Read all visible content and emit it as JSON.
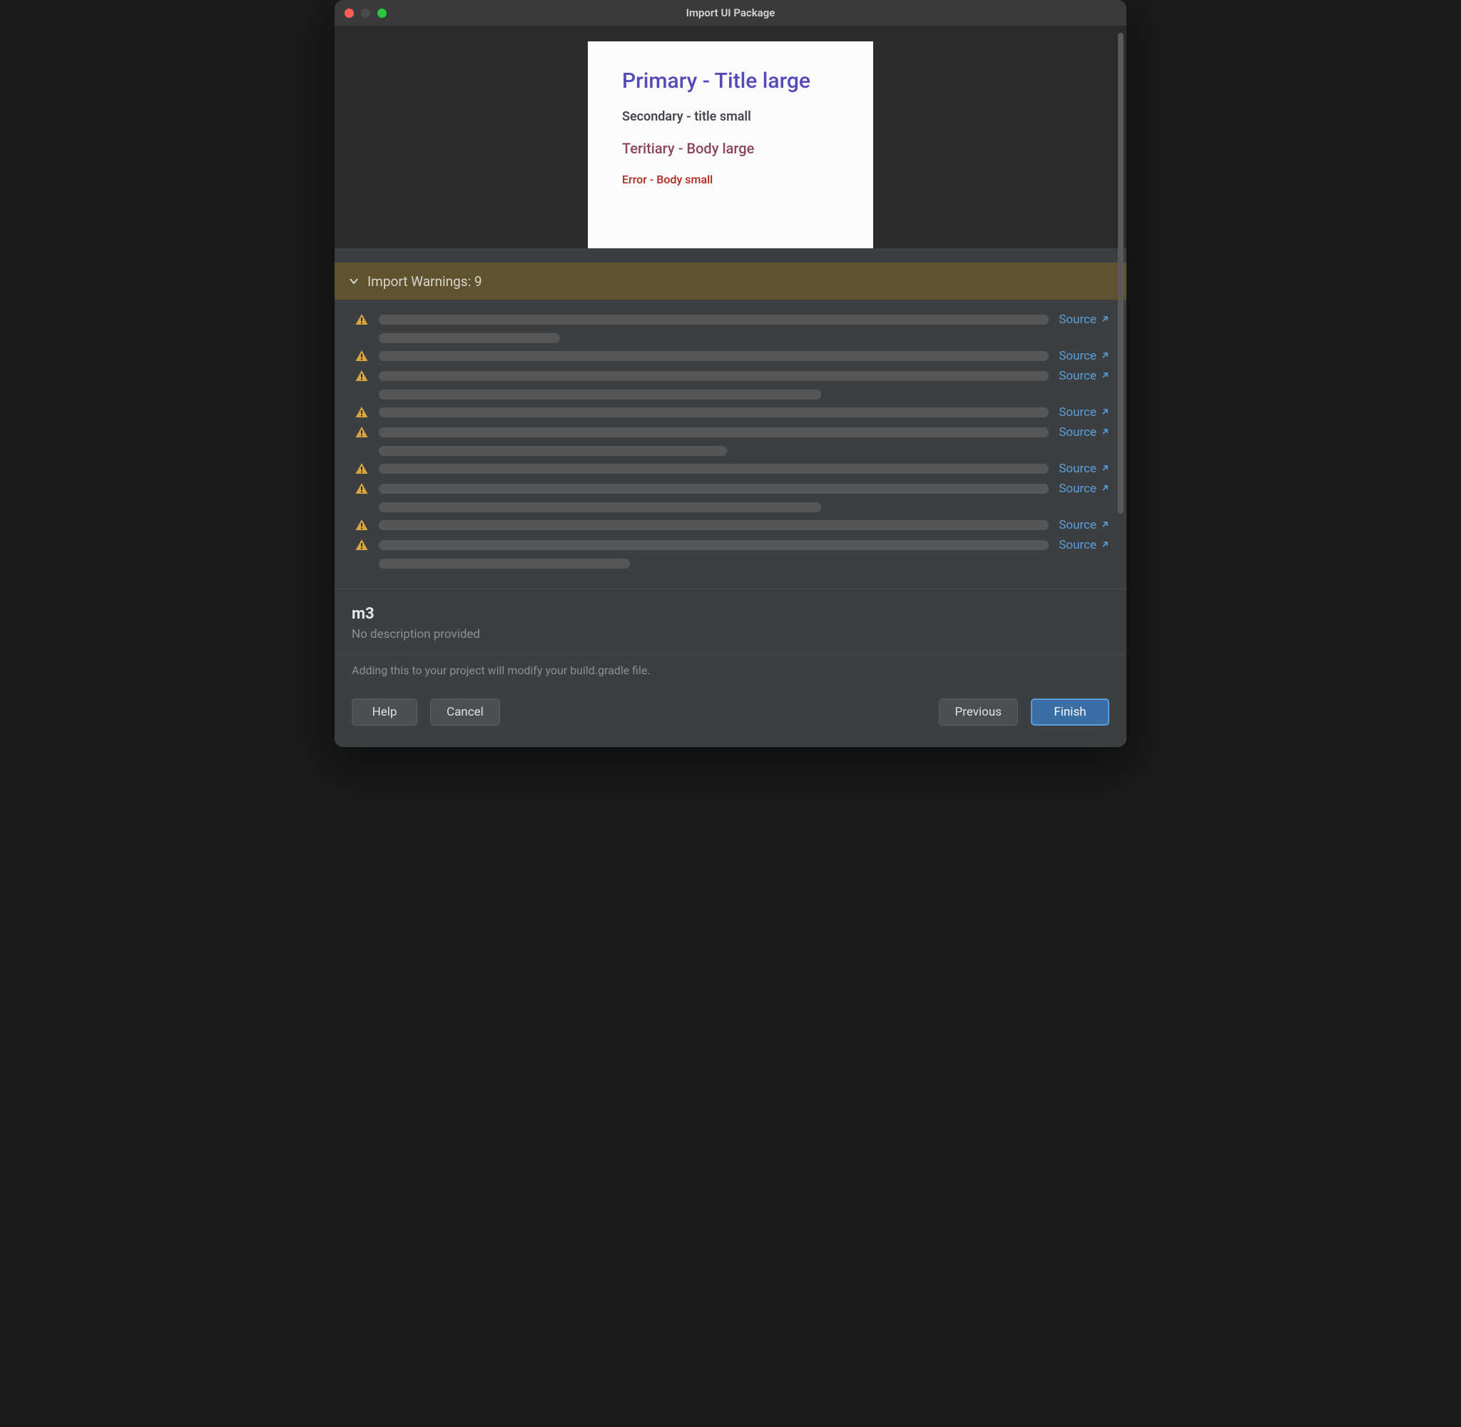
{
  "window": {
    "title": "Import UI Package"
  },
  "preview": {
    "title_large": "Primary - Title large",
    "title_small": "Secondary - title small",
    "body_large": "Teritiary - Body large",
    "body_small": "Error - Body small"
  },
  "warnings": {
    "header_label": "Import Warnings: 9",
    "count": 9,
    "source_label": "Source",
    "items": [
      {
        "lines": [
          100,
          27
        ]
      },
      {
        "lines": [
          100
        ]
      },
      {
        "lines": [
          100,
          66
        ]
      },
      {
        "lines": [
          100
        ]
      },
      {
        "lines": [
          100,
          52
        ]
      },
      {
        "lines": [
          100
        ]
      },
      {
        "lines": [
          100,
          66
        ]
      },
      {
        "lines": [
          100
        ]
      },
      {
        "lines": [
          100,
          37.5
        ]
      }
    ]
  },
  "package": {
    "name": "m3",
    "description": "No description provided"
  },
  "footer": {
    "note": "Adding this to your project will modify your build.gradle file.",
    "help": "Help",
    "cancel": "Cancel",
    "previous": "Previous",
    "finish": "Finish"
  }
}
